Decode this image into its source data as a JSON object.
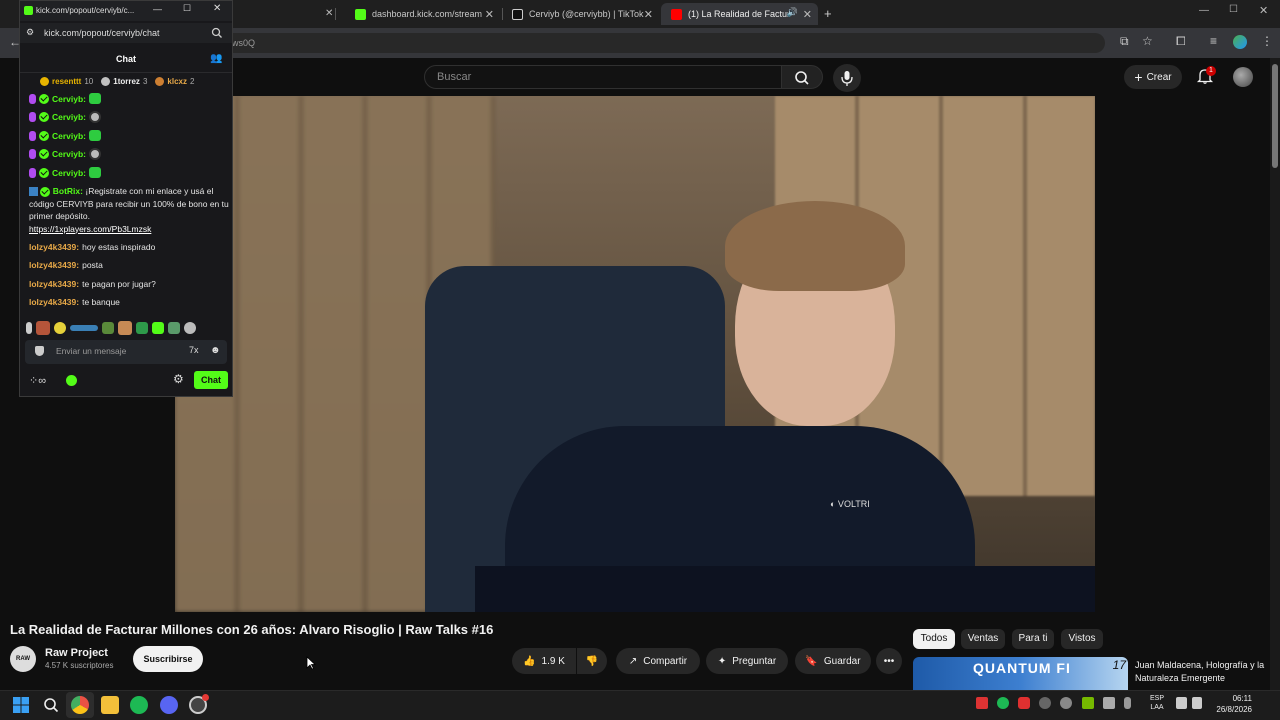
{
  "browser": {
    "tabs": [
      {
        "label": "kick.com/popout/cerviyb/c...",
        "x": 0
      },
      {
        "label": "",
        "x": 0
      },
      {
        "label": "dashboard.kick.com/stream"
      },
      {
        "label": "Cerviyb (@cerviybb) | TikTok"
      },
      {
        "label": "(1) La Realidad de Facturar M..."
      }
    ],
    "url_fragment": "dws0Q"
  },
  "kick": {
    "window_title": "kick.com/popout/cerviyb/c...",
    "url": "kick.com/popout/cerviyb/chat",
    "chat_header": "Chat",
    "leaderboard": [
      {
        "name": "resenttt",
        "count": "10",
        "color": "#e8b400"
      },
      {
        "name": "1torrez",
        "count": "3",
        "color": "#c0c0c0"
      },
      {
        "name": "klcxz",
        "count": "2",
        "color": "#cd7f32"
      }
    ],
    "messages": [
      {
        "user": "Cerviyb:",
        "emote": "green"
      },
      {
        "user": "Cerviyb:",
        "emote": "skull"
      },
      {
        "user": "Cerviyb:",
        "emote": "green"
      },
      {
        "user": "Cerviyb:",
        "emote": "skull"
      },
      {
        "user": "Cerviyb:",
        "emote": "green"
      }
    ],
    "bot": {
      "user": "BotRix:",
      "text": "¡Registrate con mi enlace y usá el código CERVIYB para recibir un 100% de bono en tu primer depósito.",
      "link": "https://1xplayers.com/Pb3Lmzsk"
    },
    "user_messages": [
      {
        "user": "lolzy4k3439:",
        "text": "hoy estas inspirado"
      },
      {
        "user": "lolzy4k3439:",
        "text": "posta"
      },
      {
        "user": "lolzy4k3439:",
        "text": "te pagan por jugar?"
      },
      {
        "user": "lolzy4k3439:",
        "text": "te banque"
      }
    ],
    "input_placeholder": "Enviar un mensaje",
    "send_label": "Chat",
    "brand_color": "#53fc18",
    "name_color": "#e8a948"
  },
  "youtube": {
    "search_placeholder": "Buscar",
    "create_label": "Crear",
    "notifications": "1",
    "video_title": "La Realidad de Facturar Millones con 26 años: Alvaro Risoglio | Raw Talks #16",
    "channel": {
      "avatar": "RAW",
      "name": "Raw Project",
      "subs": "4.57 K suscriptores"
    },
    "subscribe_label": "Suscribirse",
    "likes": "1.9 K",
    "share_label": "Compartir",
    "ask_label": "Preguntar",
    "save_label": "Guardar",
    "chips": [
      "Todos",
      "Ventas",
      "Para ti",
      "Vistos"
    ],
    "recommendation": {
      "thumb_text": "QUANTUM FI",
      "badge": "17",
      "title": "Juan Maldacena, Holografía y la Naturaleza Emergente"
    }
  },
  "taskbar": {
    "lang_line1": "ESP",
    "lang_line2": "LAA",
    "time": "06:11",
    "date": "26/8/2026"
  }
}
